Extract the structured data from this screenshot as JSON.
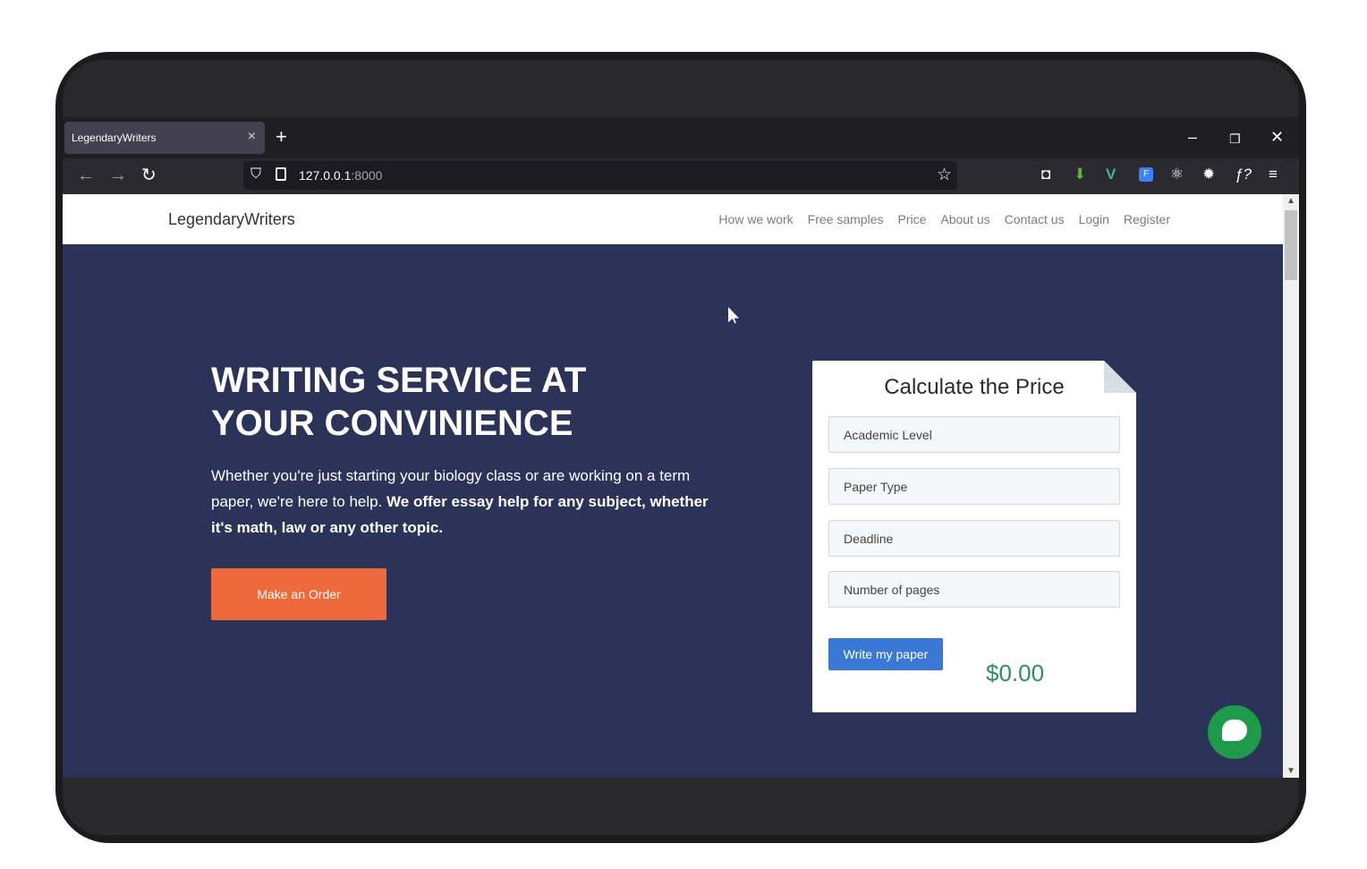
{
  "browser": {
    "tab_title": "LegendaryWriters",
    "tab_close": "×",
    "new_tab": "+",
    "url_host": "127.0.0.1",
    "url_port": ":8000",
    "window_controls": {
      "minimize": "–",
      "restore": "❐",
      "close": "✕"
    },
    "nav": {
      "back": "←",
      "forward": "→",
      "reload": "↻"
    },
    "extensions": [
      "pocket-icon",
      "download-icon",
      "vue-icon",
      "font-icon",
      "react-icon",
      "gear-icon",
      "formula-icon",
      "menu-icon"
    ]
  },
  "site": {
    "brand": "LegendaryWriters",
    "menu": [
      "How we work",
      "Free samples",
      "Price",
      "About us",
      "Contact us",
      "Login",
      "Register"
    ]
  },
  "hero": {
    "title_line1": "WRITING SERVICE AT",
    "title_line2": "YOUR CONVINIENCE",
    "desc_plain": "Whether you're just starting your biology class or are working on a term paper, we're here to help. ",
    "desc_bold": "We offer essay help for any subject, whether it's math, law or any other topic.",
    "order_button": "Make an Order"
  },
  "calculator": {
    "title": "Calculate the Price",
    "fields": [
      "Academic Level",
      "Paper Type",
      "Deadline",
      "Number of pages"
    ],
    "write_button": "Write my paper",
    "price": "$0.00"
  },
  "colors": {
    "hero_bg": "#2b3358",
    "order_button": "#ef6a3b",
    "write_button": "#3a78d6",
    "price": "#2f8f55",
    "chat_button": "#1d9b4b"
  }
}
